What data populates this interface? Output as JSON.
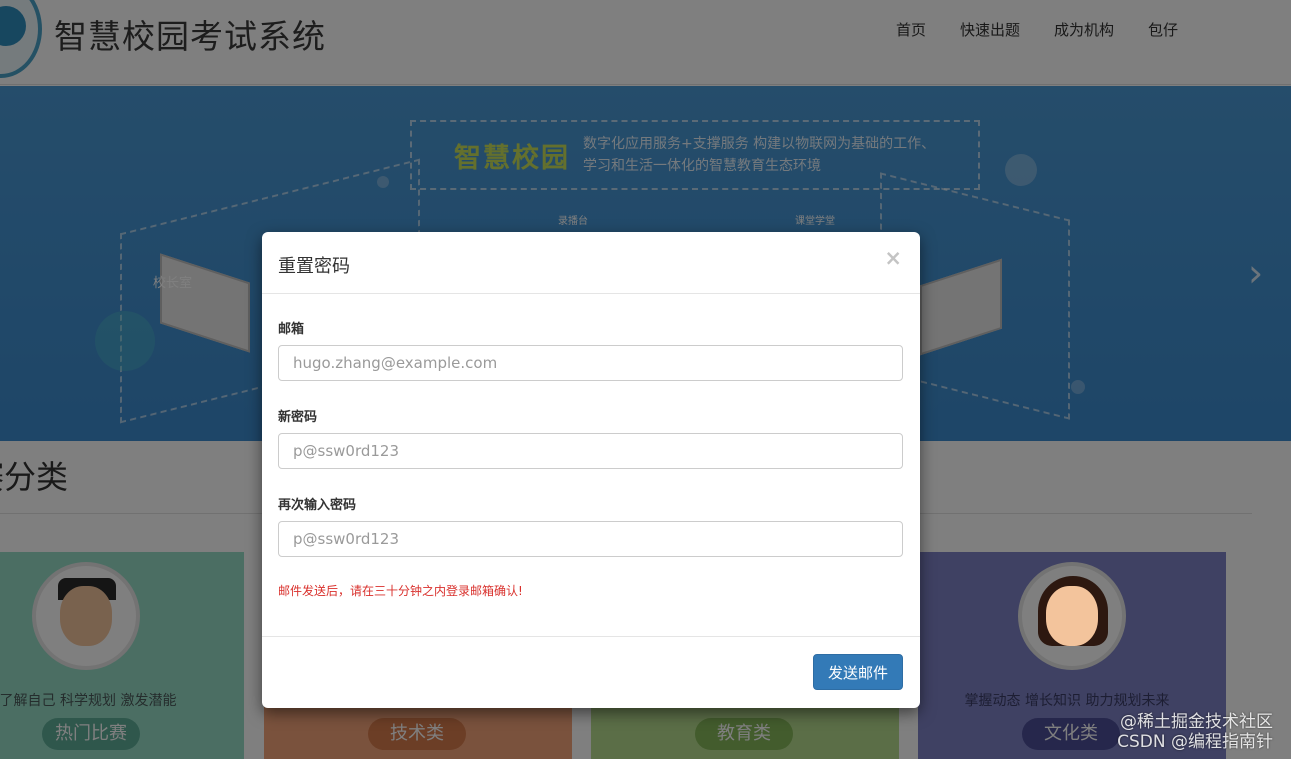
{
  "header": {
    "site_title": "智慧校园考试系统",
    "nav": [
      "首页",
      "快速出题",
      "成为机构",
      "包仔"
    ]
  },
  "banner": {
    "brand": "智慧校园",
    "slogan": "数字化应用服务+支撑服务 构建以物联网为基础的工作、学习和生活一体化的智慧教育生态环境",
    "labels": {
      "principal": "校长室",
      "record": "录播台",
      "class": "课堂学堂"
    }
  },
  "section": {
    "title": "赛分类",
    "cards": [
      {
        "tagline": "了解自己 科学规划 激发潜能",
        "badge": "热门比赛"
      },
      {
        "tagline": "",
        "badge": "技术类"
      },
      {
        "tagline": "",
        "badge": "教育类"
      },
      {
        "tagline": "掌握动态 增长知识 助力规划未来",
        "badge": "文化类"
      }
    ]
  },
  "modal": {
    "title": "重置密码",
    "close": "×",
    "email_label": "邮箱",
    "email_placeholder": "hugo.zhang@example.com",
    "new_label": "新密码",
    "new_placeholder": "p@ssw0rd123",
    "repeat_label": "再次输入密码",
    "repeat_placeholder": "p@ssw0rd123",
    "hint": "邮件发送后，请在三十分钟之内登录邮箱确认!",
    "send_label": "发送邮件"
  },
  "watermark": {
    "line1": "@稀土掘金技术社区",
    "line2": "CSDN @编程指南针"
  },
  "colors": {
    "primary_button": "#337ab7",
    "hint_text": "#d9302c",
    "banner": "#4b9ad6"
  }
}
